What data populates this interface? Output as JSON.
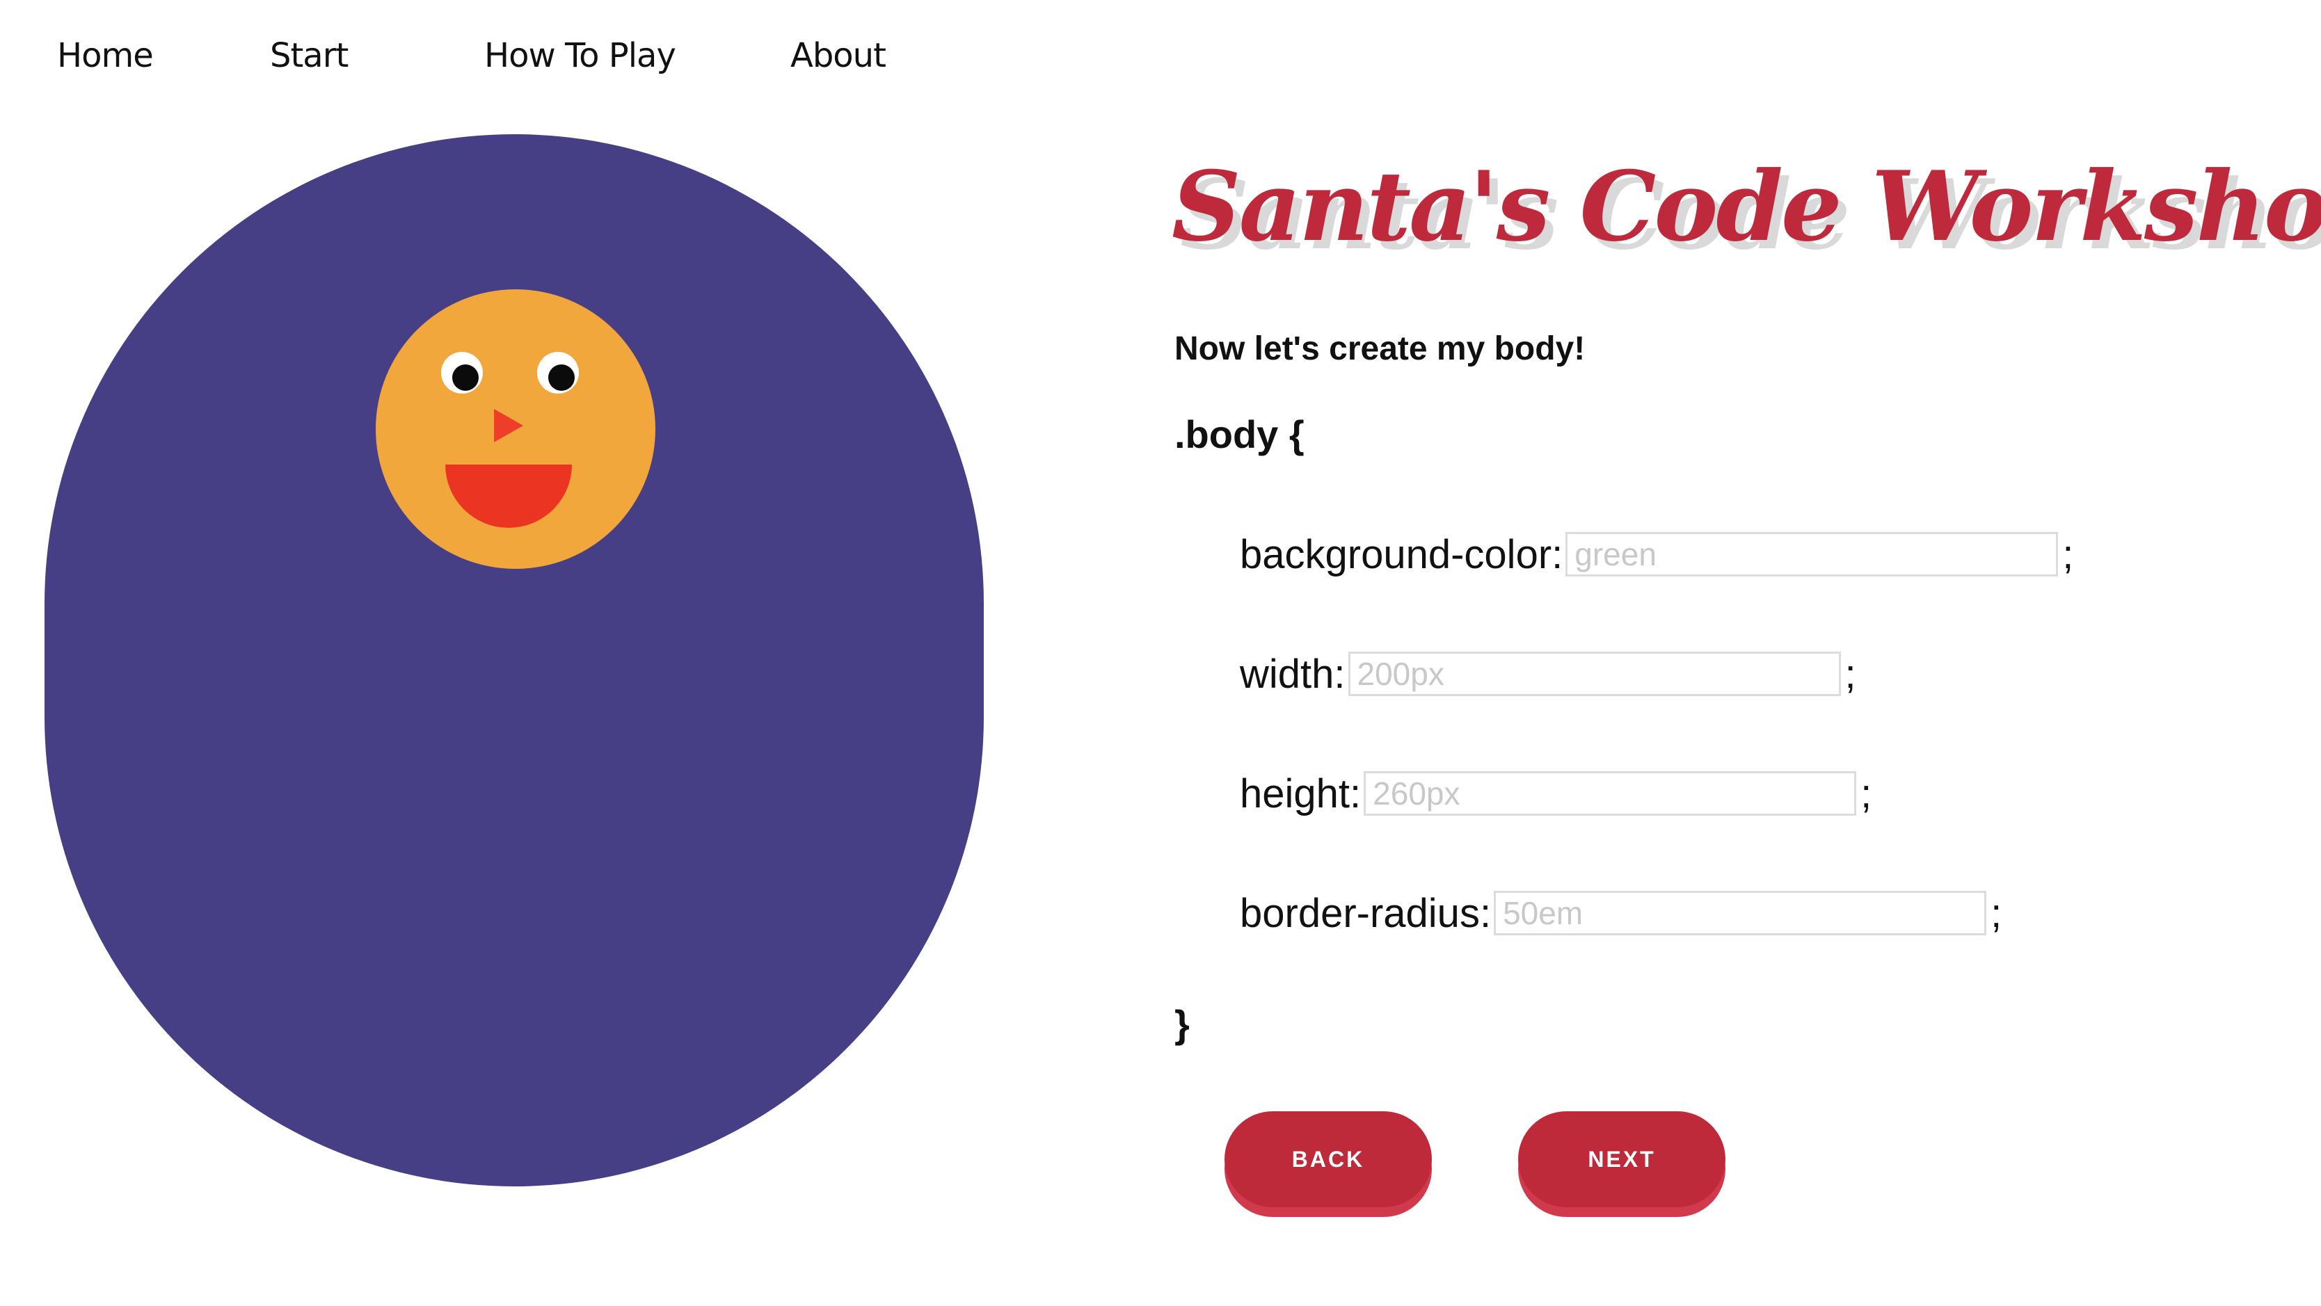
{
  "nav": {
    "items": [
      {
        "label": "Home"
      },
      {
        "label": "Start"
      },
      {
        "label": "How To Play"
      },
      {
        "label": "About"
      }
    ]
  },
  "character": {
    "body_color": "#463f85",
    "head_color": "#f2a73d",
    "mouth_color": "#ec3423",
    "nose_color": "#ee3d28"
  },
  "main": {
    "title": "Santa's Code Workshop",
    "subtitle": "Now let's create my body!",
    "code_open": ".body {",
    "code_close": "}",
    "properties": [
      {
        "label": "background-color:",
        "value": "",
        "placeholder": "green"
      },
      {
        "label": "width:",
        "value": "",
        "placeholder": "200px"
      },
      {
        "label": "height:",
        "value": "",
        "placeholder": "260px"
      },
      {
        "label": "border-radius:",
        "value": "",
        "placeholder": "50em"
      }
    ],
    "semicolon": ";"
  },
  "buttons": {
    "back_label": "BACK",
    "next_label": "NEXT"
  },
  "colors": {
    "accent": "#be2a3b",
    "button_shadow": "#d13a4d"
  }
}
